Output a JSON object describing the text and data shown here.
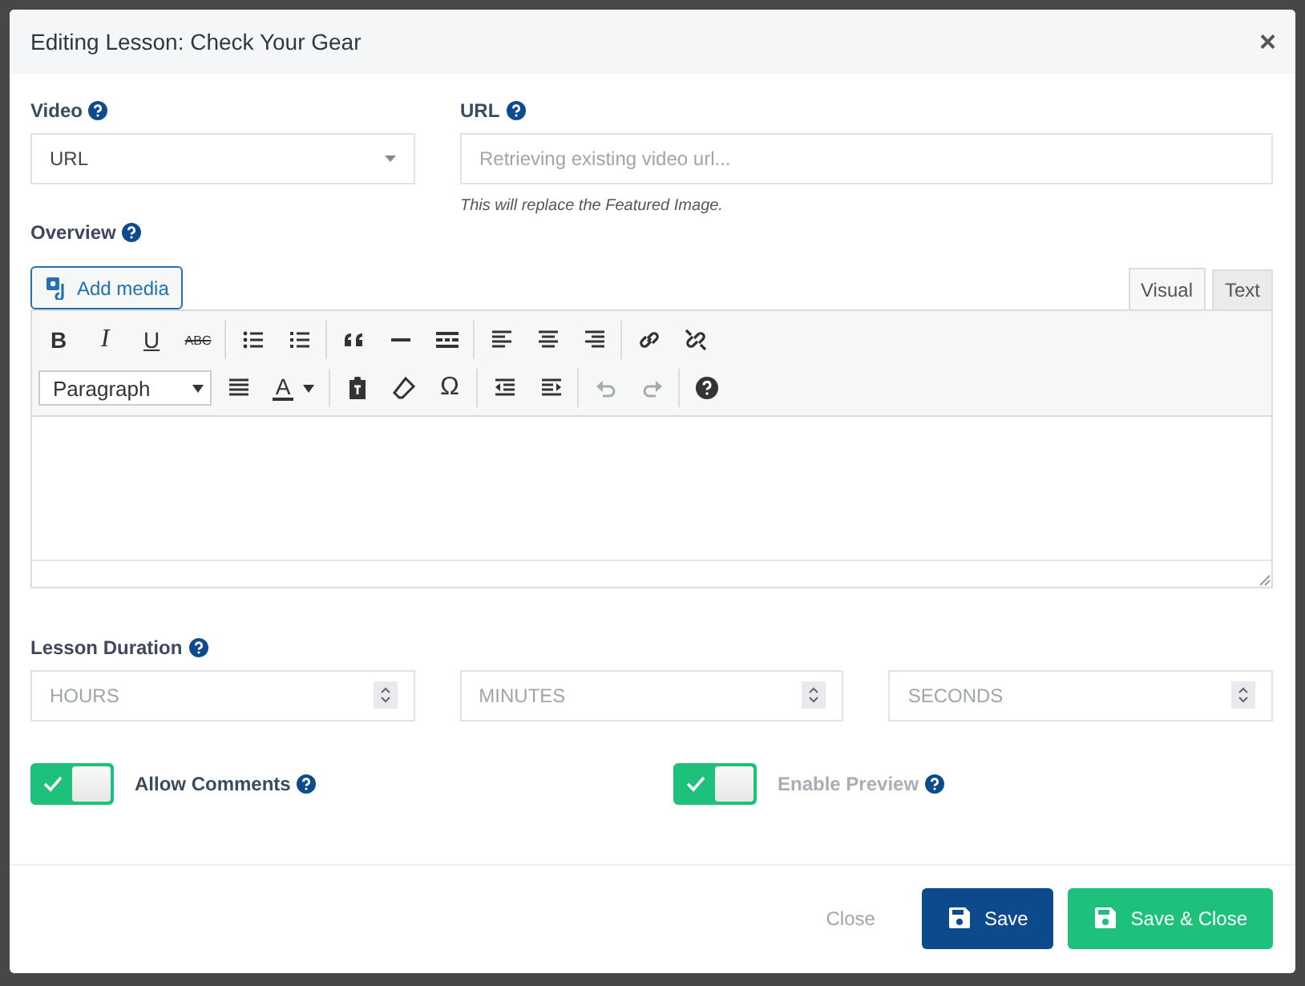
{
  "window": {
    "title": "Editing Lesson: Check Your Gear",
    "close": "×"
  },
  "video": {
    "label": "Video",
    "value": "URL"
  },
  "url": {
    "label": "URL",
    "placeholder": "Retrieving existing video url...",
    "hint": "This will replace the Featured Image."
  },
  "overview": {
    "label": "Overview",
    "add_media": "Add media",
    "tabs": [
      {
        "label": "Visual",
        "selected": true
      },
      {
        "label": "Text",
        "selected": false
      }
    ],
    "toolbar": [
      [
        {
          "kind": "bold",
          "label": "B"
        },
        {
          "kind": "italic",
          "label": "I"
        },
        {
          "kind": "underline",
          "label": "U"
        },
        {
          "kind": "strike",
          "label": "ABC"
        },
        {
          "kind": "sep"
        },
        {
          "kind": "bullets"
        },
        {
          "kind": "numbers"
        },
        {
          "kind": "sep"
        },
        {
          "kind": "quote"
        },
        {
          "kind": "hr"
        },
        {
          "kind": "more"
        },
        {
          "kind": "sep"
        },
        {
          "kind": "align-left"
        },
        {
          "kind": "align-center"
        },
        {
          "kind": "align-right"
        },
        {
          "kind": "sep"
        },
        {
          "kind": "link"
        },
        {
          "kind": "unlink"
        }
      ],
      [
        {
          "kind": "select",
          "label": "Paragraph"
        },
        {
          "kind": "justify"
        },
        {
          "kind": "color",
          "label": "A"
        },
        {
          "kind": "sep"
        },
        {
          "kind": "paste"
        },
        {
          "kind": "eraser"
        },
        {
          "kind": "char",
          "label": "Ω"
        },
        {
          "kind": "sep"
        },
        {
          "kind": "outdent"
        },
        {
          "kind": "indent"
        },
        {
          "kind": "sep"
        },
        {
          "kind": "undo",
          "disabled": true
        },
        {
          "kind": "redo",
          "disabled": true
        },
        {
          "kind": "sep"
        },
        {
          "kind": "help"
        }
      ]
    ]
  },
  "duration": {
    "label": "Lesson Duration",
    "fields": [
      {
        "placeholder": "HOURS"
      },
      {
        "placeholder": "MINUTES"
      },
      {
        "placeholder": "SECONDS"
      }
    ]
  },
  "toggles": [
    {
      "label": "Allow Comments",
      "on": true,
      "disabled": false
    },
    {
      "label": "Enable Preview",
      "on": true,
      "disabled": true
    }
  ],
  "footer": {
    "close": "Close",
    "save": "Save",
    "save_close": "Save & Close"
  }
}
